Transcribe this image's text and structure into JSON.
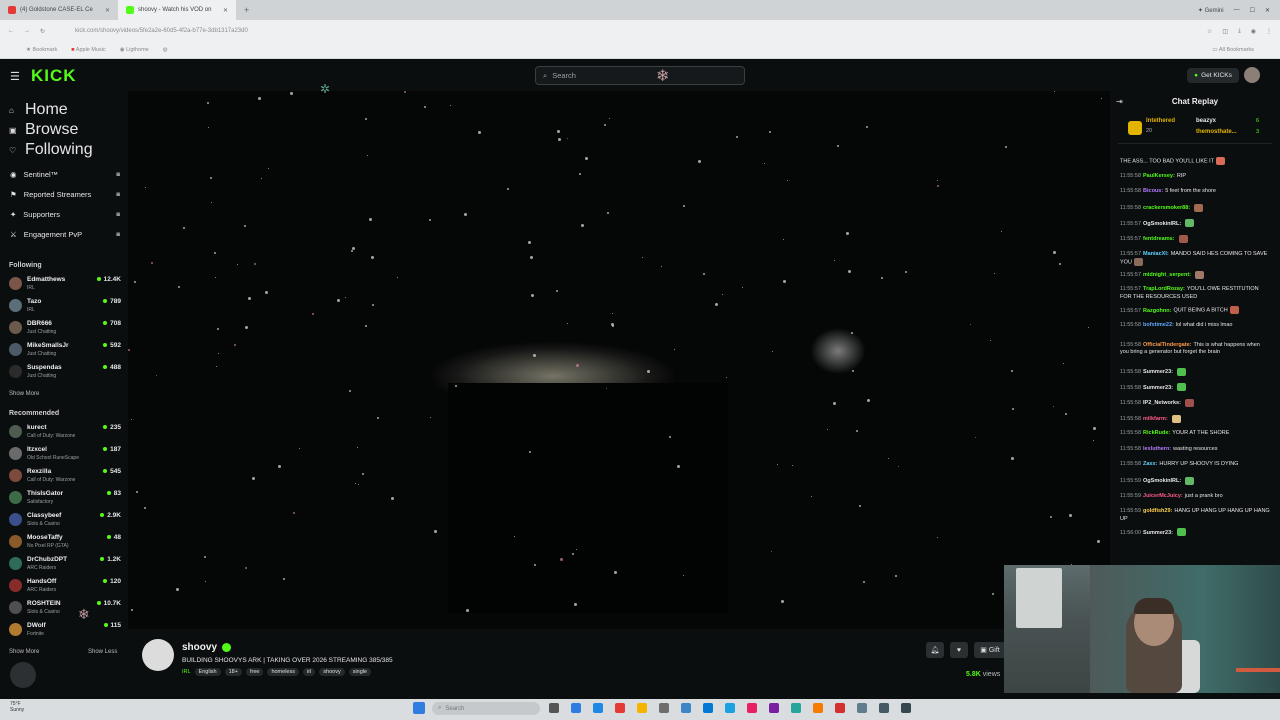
{
  "browser": {
    "tabs": [
      {
        "title": "(4) Goldstone CASE-EL Ce",
        "active": false,
        "color": "#e53935"
      },
      {
        "title": "shoovy - Watch his VOD on",
        "active": true,
        "color": "#53fc18"
      }
    ],
    "new_tab": "+",
    "profile": "Gemini",
    "url": "kick.com/shoovy/videos/5fe2a2e-60d5-4f2a-b77e-3db1317a23d0",
    "bookmarks": [
      "Bookmark",
      "Apple Music",
      "Ligthome"
    ],
    "all_bookmarks": "All Bookmarks"
  },
  "header": {
    "logo": "KICK",
    "search_placeholder": "Search",
    "get_kicks": "Get KICKs"
  },
  "sidebar": {
    "nav": [
      {
        "label": "Home",
        "icon": "home-icon",
        "glyph": "⌂"
      },
      {
        "label": "Browse",
        "icon": "browse-icon",
        "glyph": "▣"
      },
      {
        "label": "Following",
        "icon": "heart-icon",
        "glyph": "♡"
      }
    ],
    "mod_tools": [
      {
        "label": "Sentinel™",
        "icon": "shield-icon",
        "glyph": "◉"
      },
      {
        "label": "Reported Streamers",
        "icon": "flag-icon",
        "glyph": "⚑"
      },
      {
        "label": "Supporters",
        "icon": "star-icon",
        "glyph": "✦"
      },
      {
        "label": "Engagement PvP",
        "icon": "versus-icon",
        "glyph": "⚔"
      }
    ],
    "following_heading": "Following",
    "following": [
      {
        "name": "Edmatthews",
        "category": "IRL",
        "viewers": "12.4K",
        "color": "#7a5548"
      },
      {
        "name": "Tazo",
        "category": "IRL",
        "viewers": "789",
        "color": "#5c6e7a"
      },
      {
        "name": "DBR666",
        "category": "Just Chatting",
        "viewers": "708",
        "color": "#6b5a4c"
      },
      {
        "name": "MikeSmallsJr",
        "category": "Just Chatting",
        "viewers": "592",
        "color": "#4d5966"
      },
      {
        "name": "Suspendas",
        "category": "Just Chatting",
        "viewers": "488",
        "color": "#2b2b2b"
      }
    ],
    "following_show_more": "Show More",
    "recommended_heading": "Recommended",
    "recommended": [
      {
        "name": "kurect",
        "category": "Call of Duty: Warzone",
        "viewers": "235",
        "color": "#4e5b4f"
      },
      {
        "name": "Itzxcel",
        "category": "Old School RuneScape",
        "viewers": "187",
        "color": "#6a6a6a"
      },
      {
        "name": "Rexzilla",
        "category": "Call of Duty: Warzone",
        "viewers": "545",
        "color": "#7d4a3b"
      },
      {
        "name": "ThisIsGator",
        "category": "Satisfactory",
        "viewers": "83",
        "color": "#3d6b48"
      },
      {
        "name": "Classybeef",
        "category": "Slots & Casino",
        "viewers": "2.9K",
        "color": "#3b4f8a"
      },
      {
        "name": "MooseTaffy",
        "category": "No Pixel RP (GTA)",
        "viewers": "48",
        "color": "#8a5a2b"
      },
      {
        "name": "DrChubzDPT",
        "category": "ARC Raiders",
        "viewers": "1.2K",
        "color": "#2f6b5a"
      },
      {
        "name": "HandsOff",
        "category": "ARC Raiders",
        "viewers": "120",
        "color": "#8a2b2b"
      },
      {
        "name": "ROSHTEIN",
        "category": "Slots & Casino",
        "viewers": "10.7K",
        "color": "#4f4f4f"
      },
      {
        "name": "DWolf",
        "category": "Fortnite",
        "viewers": "115",
        "color": "#b07a2f"
      }
    ],
    "recommended_show_more": "Show More",
    "recommended_show_less": "Show Less"
  },
  "stream": {
    "channel": "shoovy",
    "title": "BUILDING SHOOVYS ARK | TAKING OVER 2026 STREAMING 385/385",
    "category": "IRL",
    "tags": [
      "English",
      "18+",
      "free",
      "homeless",
      "irl",
      "shoovy",
      "single"
    ],
    "views_count": "5.8K",
    "views_label": "views",
    "gift_label": "Gift"
  },
  "chat": {
    "title": "Chat Replay",
    "pinned": [
      {
        "user": "Intethered",
        "sub": "20",
        "color": "#e0b400"
      },
      {
        "user": "beazyx",
        "sub": "6",
        "color": "#e6e6e6"
      },
      {
        "user": "themosthate...",
        "sub": "3",
        "color": "#e0b400"
      }
    ],
    "messages": [
      {
        "time": "",
        "user": "",
        "user_color": "#e6e6e6",
        "text": "THE ASS... TOO BAD YOU'LL LIKE IT",
        "emote": "#d96b5a"
      },
      {
        "time": "11:55:58",
        "user": "PaulKersey:",
        "user_color": "#53fc18",
        "text": "RIP",
        "emote": ""
      },
      {
        "time": "11:55:58",
        "user": "Bicous:",
        "user_color": "#b57bff",
        "text": "5 feet from the shore",
        "emote": ""
      },
      {
        "time": "11:55:58",
        "user": "crackersmoker88:",
        "user_color": "#53fc18",
        "text": "",
        "emote": "#a06a50"
      },
      {
        "time": "11:55:57",
        "user": "OgSmokinIRL:",
        "user_color": "#e6e6e6",
        "text": "",
        "emote": "#63b96a"
      },
      {
        "time": "11:55:57",
        "user": "fentdreams:",
        "user_color": "#53fc18",
        "text": "",
        "emote": "#a05a4a"
      },
      {
        "time": "11:55:57",
        "user": "ManiacXI:",
        "user_color": "#5fd4ff",
        "text": "MANDO SAID HES COMING TO SAVE YOU",
        "emote": "#8a6b5a"
      },
      {
        "time": "11:55:57",
        "user": "midnight_serpent:",
        "user_color": "#53fc18",
        "text": "",
        "emote": "#a0786a"
      },
      {
        "time": "11:55:57",
        "user": "TrapLordRozay:",
        "user_color": "#53fc18",
        "text": "YOU'LL OWE RESTITUTION FOR THE RESOURCES USED",
        "emote": ""
      },
      {
        "time": "11:55:57",
        "user": "Razgohnn:",
        "user_color": "#53fc18",
        "text": "QUIT BEING A BITCH",
        "emote": "#c0604a"
      },
      {
        "time": "11:55:58",
        "user": "bofxtime22:",
        "user_color": "#5fa8ff",
        "text": "lol what did i miss lmao",
        "emote": ""
      },
      {
        "time": "11:55:58",
        "user": "OfficialTindergate:",
        "user_color": "#ff9a4a",
        "text": "This is what happens when you bring a generator but forget the brain",
        "emote": ""
      },
      {
        "time": "11:55:58",
        "user": "Summer23:",
        "user_color": "#e6e6e6",
        "text": "",
        "emote": "#4fbf4f"
      },
      {
        "time": "11:55:58",
        "user": "Summer23:",
        "user_color": "#e6e6e6",
        "text": "",
        "emote": "#4fbf4f"
      },
      {
        "time": "11:55:58",
        "user": "IP2_Networks:",
        "user_color": "#e6e6e6",
        "text": "",
        "emote": "#a0504a"
      },
      {
        "time": "11:55:58",
        "user": "milkfarm:",
        "user_color": "#ff5a8a",
        "text": "",
        "emote": "#e0c080"
      },
      {
        "time": "11:55:58",
        "user": "RickRude:",
        "user_color": "#53fc18",
        "text": "YOUR AT THE SHORE",
        "emote": ""
      },
      {
        "time": "11:55:58",
        "user": "lexluthern:",
        "user_color": "#b57bff",
        "text": "wasting resources",
        "emote": ""
      },
      {
        "time": "11:55:58",
        "user": "Zaxx:",
        "user_color": "#5fd4ff",
        "text": "HURRY UP SHOOVY IS DYING",
        "emote": ""
      },
      {
        "time": "11:55:59",
        "user": "OgSmokinIRL:",
        "user_color": "#e6e6e6",
        "text": "",
        "emote": "#63b96a"
      },
      {
        "time": "11:55:59",
        "user": "JuicerMcJuicy:",
        "user_color": "#ff5a8a",
        "text": "just a prank bro",
        "emote": ""
      },
      {
        "time": "11:55:59",
        "user": "goldfish29:",
        "user_color": "#ffd24a",
        "text": "HANG UP HANG UP HANG UP HANG UP",
        "emote": ""
      },
      {
        "time": "11:56:00",
        "user": "Summer23:",
        "user_color": "#e6e6e6",
        "text": "",
        "emote": "#4fbf4f"
      }
    ]
  },
  "taskbar": {
    "weather_temp": "75°F",
    "weather_desc": "Sunny",
    "search_placeholder": "Search"
  },
  "colors": {
    "accent": "#53fc18",
    "background": "#0b0e0f"
  }
}
